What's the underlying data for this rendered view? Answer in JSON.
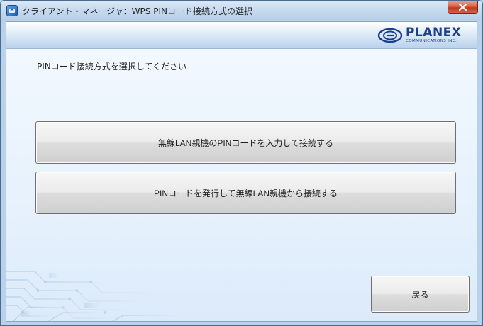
{
  "window": {
    "title": "クライアント・マネージャ：WPS PINコード接続方式の選択"
  },
  "logo": {
    "brand": "PLANEX",
    "subtitle": "COMMUNICATIONS INC."
  },
  "content": {
    "instruction": "PINコード接続方式を選択してください",
    "options": [
      {
        "label": "無線LAN親機のPINコードを入力して接続する"
      },
      {
        "label": "PINコードを発行して無線LAN親機から接続する"
      }
    ],
    "back_label": "戻る"
  },
  "colors": {
    "brand": "#1b3f8f",
    "close_button": "#c0391f",
    "title_bar": "#c5d9ee"
  }
}
